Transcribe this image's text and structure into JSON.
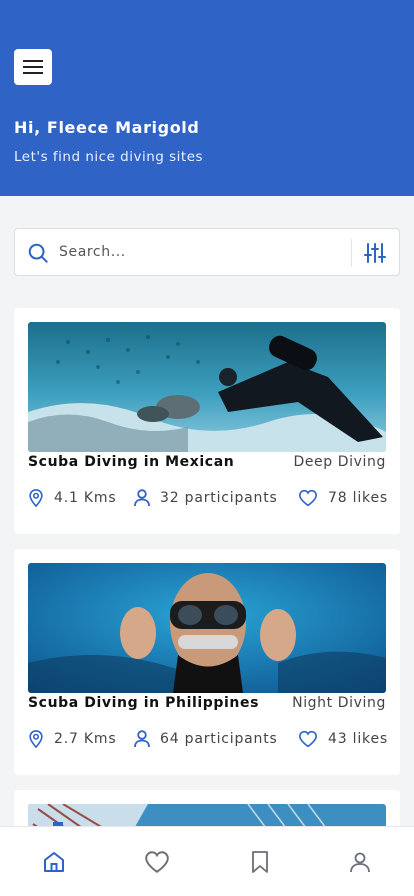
{
  "header": {
    "greeting": "Hi, Fleece Marigold",
    "subtitle": "Let's find nice diving sites",
    "color": "#2f63c6"
  },
  "search": {
    "placeholder": "Search..."
  },
  "cards": [
    {
      "title": "Scuba Diving in Mexican",
      "category": "Deep Diving",
      "distance": "4.1 Kms",
      "participants": "32 participants",
      "likes": "78 likes",
      "image_icon": "underwater-diver-photo"
    },
    {
      "title": "Scuba Diving in Philippines",
      "category": "Night Diving",
      "distance": "2.7 Kms",
      "participants": "64 participants",
      "likes": "43 likes",
      "image_icon": "diver-mask-photo"
    },
    {
      "image_icon": "lionfish-photo"
    }
  ],
  "tabbar": {
    "active": "home",
    "accent": "#2f63c6"
  }
}
